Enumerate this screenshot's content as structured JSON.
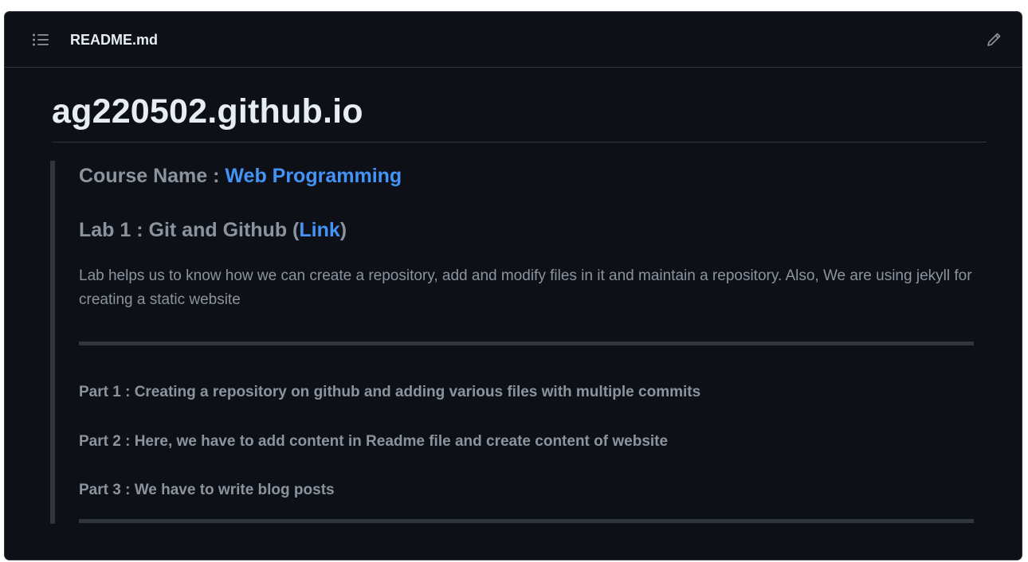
{
  "header": {
    "file_name": "README.md",
    "list_icon": "list-unordered-icon",
    "edit_icon": "pencil-icon"
  },
  "content": {
    "title": "ag220502.github.io",
    "course_prefix": "Course Name : ",
    "course_link": "Web Programming",
    "lab_prefix": "Lab 1 : Git and Github (",
    "lab_link": "Link",
    "lab_suffix": ")",
    "description": "Lab helps us to know how we can create a repository, add and modify files in it and maintain a repository. Also, We are using jekyll for creating a static website",
    "parts": [
      "Part 1 : Creating a repository on github and adding various files with multiple commits",
      "Part 2 : Here, we have to add content in Readme file and create content of website",
      "Part 3 : We have to write blog posts"
    ]
  },
  "colors": {
    "background": "#0d1117",
    "border": "#30363d",
    "text_primary": "#e6edf3",
    "text_muted": "#8b949e",
    "link": "#4493f8"
  }
}
